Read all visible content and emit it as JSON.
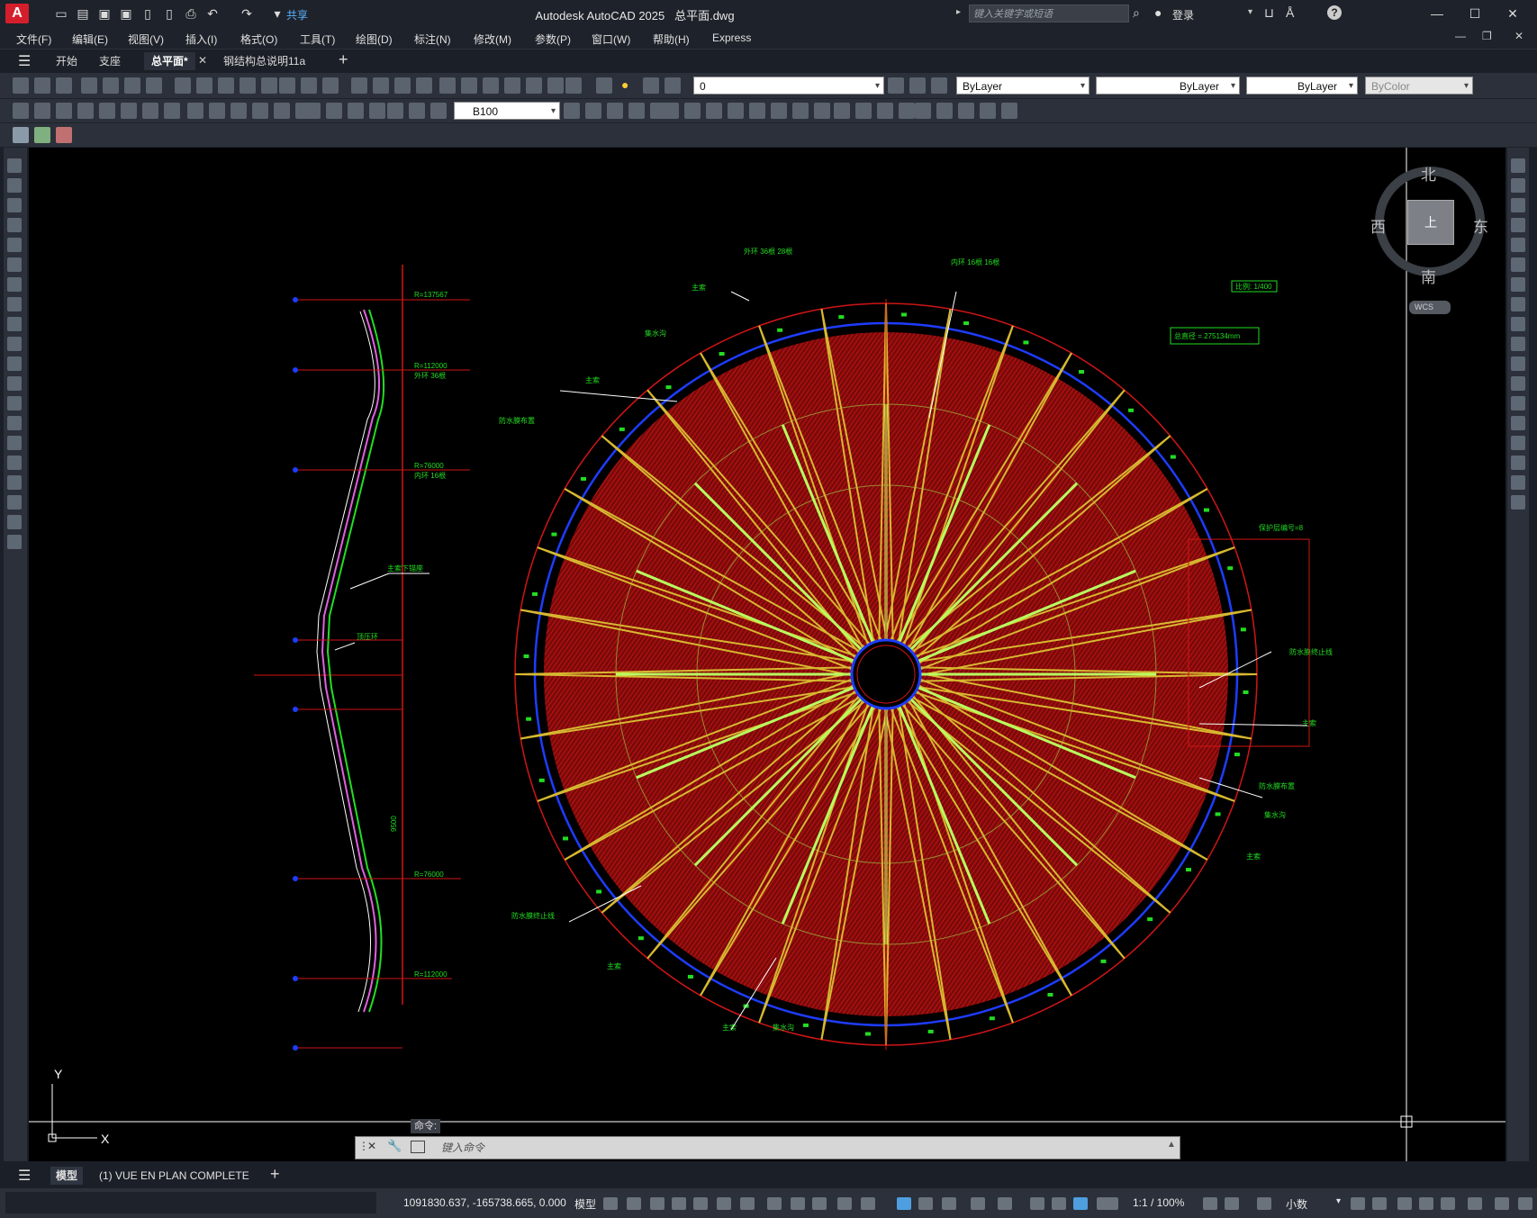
{
  "app": {
    "title": "Autodesk AutoCAD 2025",
    "filename": "总平面.dwg",
    "logo": "A",
    "search_placeholder": "键入关键字或短语",
    "login": "登录",
    "share": "共享"
  },
  "menu": [
    "文件(F)",
    "编辑(E)",
    "视图(V)",
    "插入(I)",
    "格式(O)",
    "工具(T)",
    "绘图(D)",
    "标注(N)",
    "修改(M)",
    "参数(P)",
    "窗口(W)",
    "帮助(H)",
    "Express"
  ],
  "file_tabs": [
    {
      "label": "开始",
      "active": false
    },
    {
      "label": "支座",
      "active": false
    },
    {
      "label": "总平面*",
      "active": true
    },
    {
      "label": "钢结构总说明11a",
      "active": false
    }
  ],
  "toolbar": {
    "layer_value": "0",
    "color": "ByLayer",
    "linetype": "ByLayer",
    "lineweight": "ByLayer",
    "plotstyle": "ByColor",
    "dimstyle": "B100"
  },
  "viewcube": {
    "north": "北",
    "south": "南",
    "east": "东",
    "west": "西",
    "top": "上",
    "wcs": "WCS"
  },
  "ucs": {
    "x": "X",
    "y": "Y"
  },
  "drawing": {
    "scale_box": "比例: 1/400",
    "diameter_box": "总直径 = 275134mm",
    "section_labels": [
      "R=137567",
      "R=112000",
      "外环 36根",
      "R=76000",
      "内环 16根",
      "主索下锚座",
      "顶压环",
      "R=76000",
      "R=112000"
    ],
    "plan_labels": [
      "外环 36根 28根",
      "内环 16根 16根",
      "主索",
      "集水沟",
      "主索",
      "防水膜布置",
      "保护层编号=8",
      "防水膜终止线",
      "主索",
      "防水膜布置",
      "集水沟",
      "主索",
      "防水膜终止线",
      "主索",
      "主索",
      "集水沟"
    ],
    "vertical_dim": "9500"
  },
  "command": {
    "label": "命令:",
    "placeholder": "键入命令"
  },
  "layout_tabs": [
    {
      "label": "模型",
      "active": true
    },
    {
      "label": "(1) VUE EN PLAN COMPLETE",
      "active": false
    }
  ],
  "status": {
    "coords": "1091830.637, -165738.665, 0.000",
    "model": "模型",
    "scale": "1:1 / 100%",
    "units": "小数"
  }
}
